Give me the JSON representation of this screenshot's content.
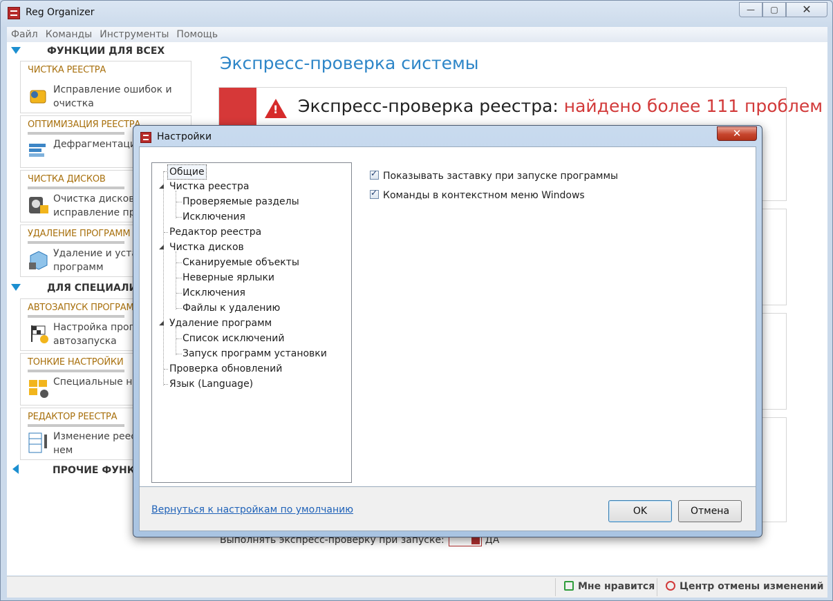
{
  "window": {
    "title": "Reg Organizer",
    "min": "—",
    "max": "▢",
    "close": "✕"
  },
  "menu": [
    "Файл",
    "Команды",
    "Инструменты",
    "Помощь"
  ],
  "sidebar": {
    "section1": "ФУНКЦИИ ДЛЯ ВСЕХ",
    "section2": "ДЛЯ СПЕЦИАЛИС",
    "section3": "ПРОЧИЕ ФУНКЦ",
    "cards": [
      {
        "title": "ЧИСТКА РЕЕСТРА",
        "desc": "Исправление ошибок и очистка"
      },
      {
        "title": "ОПТИМИЗАЦИЯ РЕЕСТРА",
        "desc": "Дефрагментация реестра"
      },
      {
        "title": "ЧИСТКА ДИСКОВ",
        "desc": "Очистка дисков и исправление пр"
      },
      {
        "title": "УДАЛЕНИЕ ПРОГРАММ",
        "desc": "Удаление и устан программ"
      },
      {
        "title": "АВТОЗАПУСК ПРОГРАММ",
        "desc": "Настройка прогр автозапуска"
      },
      {
        "title": "ТОНКИЕ НАСТРОЙКИ",
        "desc": "Специальные на системы"
      },
      {
        "title": "РЕДАКТОР РЕЕСТРА",
        "desc": "Изменение реес поиск в нем"
      }
    ]
  },
  "main": {
    "title": "Экспресс-проверка системы",
    "panel_title": "Экспресс-проверка реестра: ",
    "panel_highlight": "найдено более 111 проблем",
    "express_label": "Выполнять экспресс-проверку при запуске:",
    "express_value": "ДА"
  },
  "status": {
    "like": "Мне нравится",
    "undo": "Центр отмены изменений"
  },
  "dialog": {
    "title": "Настройки",
    "close": "✕",
    "tree": [
      {
        "label": "Общие",
        "level": 0,
        "selected": true
      },
      {
        "label": "Чистка реестра",
        "level": 0,
        "expander": "◢"
      },
      {
        "label": "Проверяемые разделы",
        "level": 1
      },
      {
        "label": "Исключения",
        "level": 1
      },
      {
        "label": "Редактор реестра",
        "level": 0
      },
      {
        "label": "Чистка дисков",
        "level": 0,
        "expander": "◢"
      },
      {
        "label": "Сканируемые объекты",
        "level": 1
      },
      {
        "label": "Неверные ярлыки",
        "level": 1
      },
      {
        "label": "Исключения",
        "level": 1
      },
      {
        "label": "Файлы к удалению",
        "level": 1
      },
      {
        "label": "Удаление программ",
        "level": 0,
        "expander": "◢"
      },
      {
        "label": "Список исключений",
        "level": 1
      },
      {
        "label": "Запуск программ установки",
        "level": 1
      },
      {
        "label": "Проверка обновлений",
        "level": 0
      },
      {
        "label": "Язык (Language)",
        "level": 0
      }
    ],
    "options": [
      {
        "label": "Показывать заставку при запуске программы",
        "checked": true
      },
      {
        "label": "Команды в контекстном меню Windows",
        "checked": true
      }
    ],
    "reset_link": "Вернуться к настройкам по умолчанию",
    "ok": "OK",
    "cancel": "Отмена"
  }
}
